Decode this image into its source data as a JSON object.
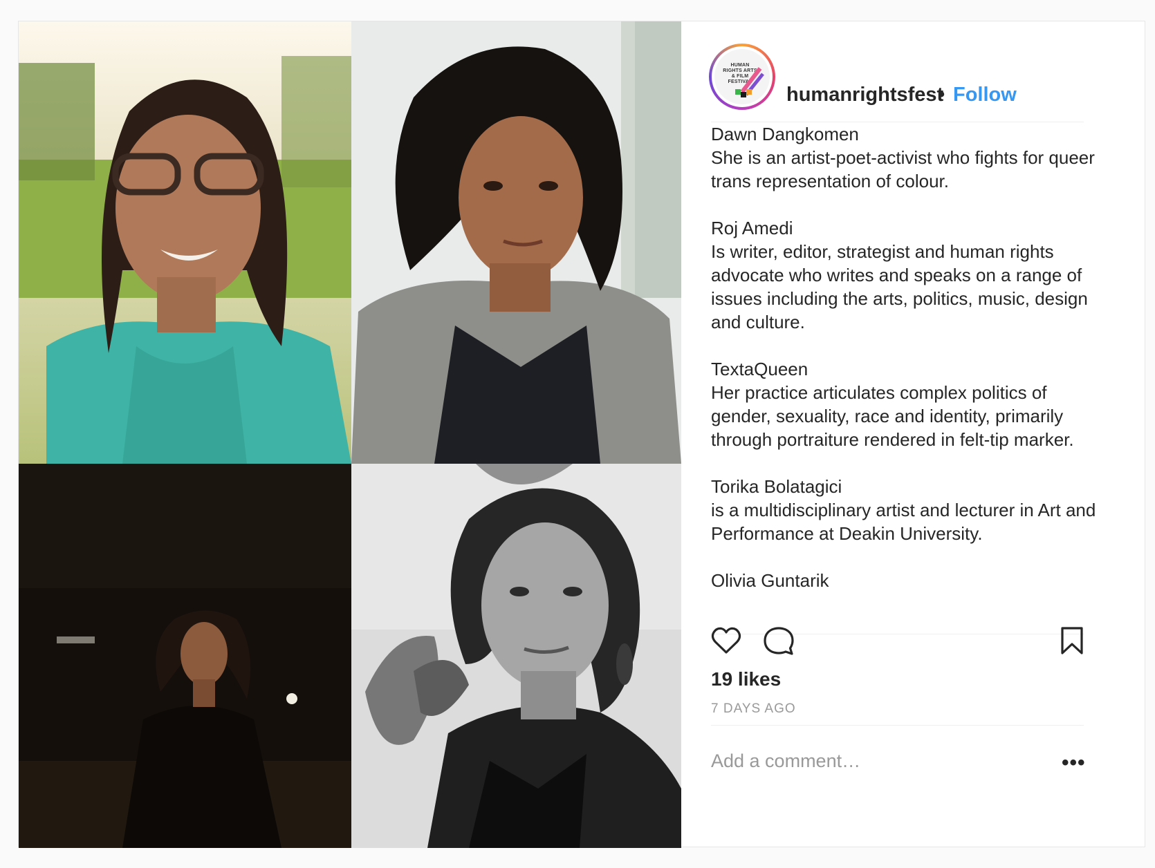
{
  "post": {
    "username": "humanrightsfest",
    "separator": "•",
    "follow_label": "Follow",
    "avatar_text": "HUMAN RIGHTS ARTS & FILM FESTIVAL",
    "caption": [
      {
        "name": "Dawn Dangkomen",
        "bio": "She is an artist-poet-activist who fights for queer trans representation of colour."
      },
      {
        "name": "Roj Amedi",
        "bio": "Is writer, editor, strategist and human rights advocate who writes and speaks on a range of issues including the arts, politics, music, design and culture."
      },
      {
        "name": "TextaQueen",
        "bio": "Her practice articulates complex politics of gender, sexuality, race and identity, primarily through portraiture rendered in felt-tip marker."
      },
      {
        "name": "Torika Bolatagici",
        "bio": "is a multidisciplinary artist and lecturer in Art and Performance at Deakin University."
      },
      {
        "name": "Olivia Guntarik",
        "bio": ""
      }
    ],
    "likes": "19 likes",
    "timestamp": "7 DAYS AGO",
    "comment_placeholder": "Add a comment…",
    "more_label": "•••"
  },
  "icons": {
    "like": "heart-icon",
    "comment": "comment-icon",
    "save": "bookmark-icon",
    "more": "more-options-icon"
  },
  "colors": {
    "link": "#3897f0",
    "text": "#262626",
    "muted": "#999999",
    "border": "#efefef"
  }
}
